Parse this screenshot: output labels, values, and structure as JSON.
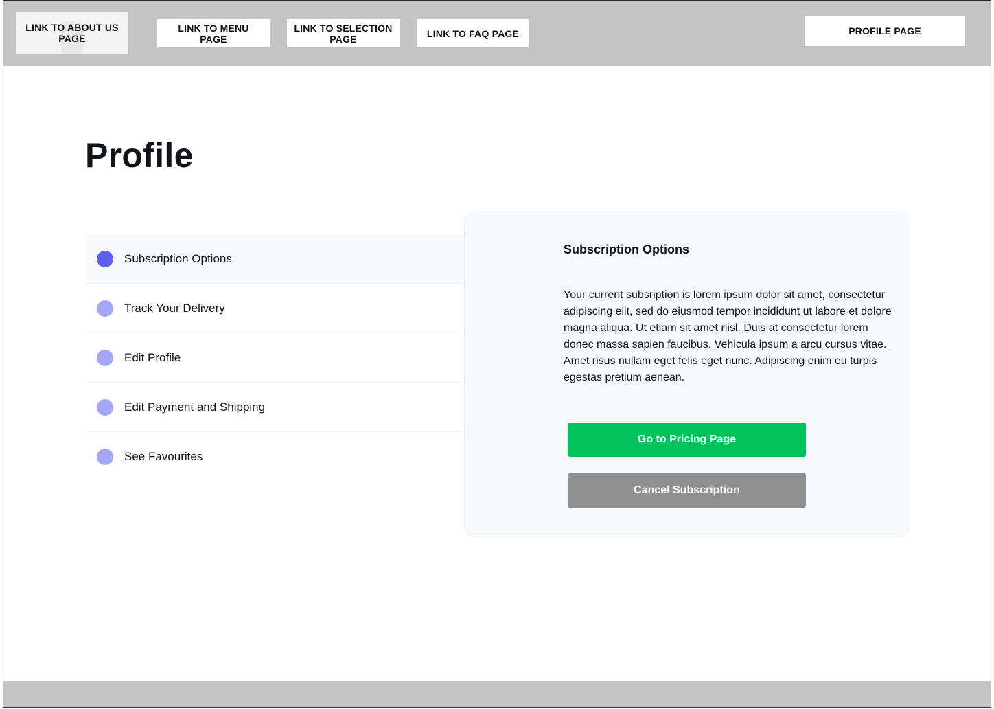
{
  "nav": {
    "about_label": "LINK TO ABOUT US PAGE",
    "menu_label": "LINK TO MENU PAGE",
    "selection_label": "LINK TO SELECTION PAGE",
    "faq_label": "LINK TO FAQ PAGE",
    "profile_label": "PROFILE PAGE"
  },
  "page": {
    "title": "Profile"
  },
  "menu": {
    "items": [
      {
        "label": "Subscription Options",
        "active": true
      },
      {
        "label": "Track Your Delivery",
        "active": false
      },
      {
        "label": "Edit Profile",
        "active": false
      },
      {
        "label": "Edit Payment and Shipping",
        "active": false
      },
      {
        "label": "See Favourites",
        "active": false
      }
    ]
  },
  "panel": {
    "title": "Subscription Options",
    "body": "Your current subsription is lorem ipsum dolor sit amet, consectetur adipiscing elit, sed do eiusmod tempor incididunt ut labore et dolore magna aliqua. Ut etiam sit amet nisl. Duis at consectetur lorem donec massa sapien faucibus. Vehicula ipsum a arcu cursus vitae. Amet risus nullam eget felis eget nunc. Adipiscing enim eu turpis egestas pretium aenean.",
    "primary_button": "Go to Pricing Page",
    "secondary_button": "Cancel Subscription"
  },
  "colors": {
    "accent": "#5d5fef",
    "accent_light": "#a5a6f6",
    "primary_button": "#00c35b",
    "secondary_button": "#8f8f8f",
    "bar": "#c4c4c4"
  },
  "icons": {
    "chevron": "chevron-right-icon",
    "bullet": "circle-dot-icon"
  }
}
